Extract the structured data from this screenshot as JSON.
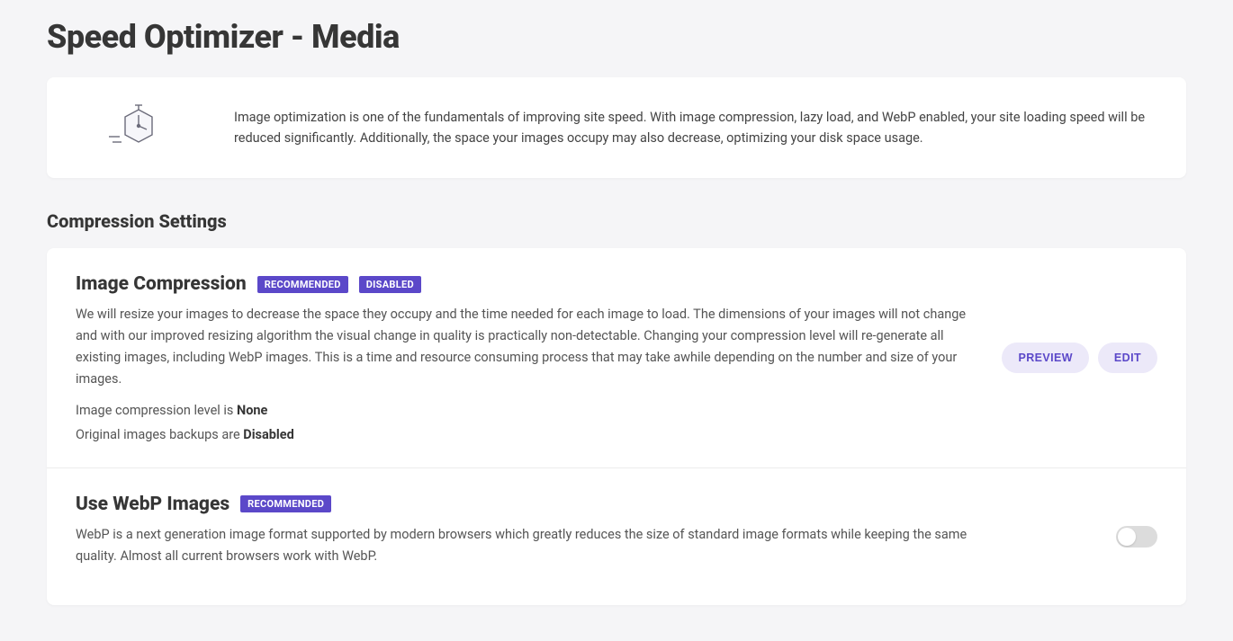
{
  "page_title": "Speed Optimizer - Media",
  "intro": {
    "text": "Image optimization is one of the fundamentals of improving site speed. With image compression, lazy load, and WebP enabled, your site loading speed will be reduced significantly. Additionally, the space your images occupy may also decrease, optimizing your disk space usage."
  },
  "section_title": "Compression Settings",
  "image_compression": {
    "title": "Image Compression",
    "badge_recommended": "RECOMMENDED",
    "badge_disabled": "DISABLED",
    "description": "We will resize your images to decrease the space they occupy and the time needed for each image to load. The dimensions of your images will not change and with our improved resizing algorithm the visual change in quality is practically non-detectable. Changing your compression level will re-generate all existing images, including WebP images. This is a time and resource consuming process that may take awhile depending on the number and size of your images.",
    "level_label": "Image compression level is ",
    "level_value": "None",
    "backup_label": "Original images backups are ",
    "backup_value": "Disabled",
    "preview_btn": "PREVIEW",
    "edit_btn": "EDIT"
  },
  "webp": {
    "title": "Use WebP Images",
    "badge_recommended": "RECOMMENDED",
    "description": "WebP is a next generation image format supported by modern browsers which greatly reduces the size of standard image formats while keeping the same quality. Almost all current browsers work with WebP.",
    "enabled": false
  }
}
